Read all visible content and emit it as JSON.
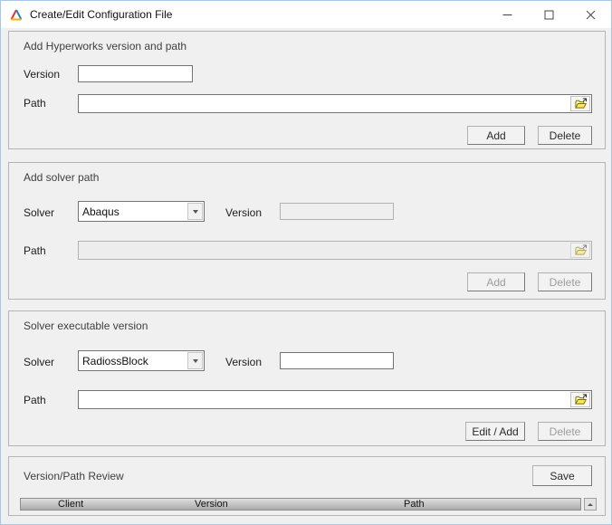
{
  "window": {
    "title": "Create/Edit Configuration File",
    "icons": {
      "app": "altair-triangle-logo",
      "minimize": "minimize-dash",
      "maximize": "maximize-square",
      "close": "close-x",
      "browse": "open-folder",
      "combo_arrow": "chevron-down"
    }
  },
  "colors": {
    "window_border": "#a7c7e7",
    "dialog_bg": "#f0f0f0",
    "titlebar_bg": "#ffffff",
    "folder_yellow": "#ffe75c",
    "disabled_text": "#9d9d9d"
  },
  "groups": {
    "hyperworks": {
      "title": "Add Hyperworks version and path",
      "version_label": "Version",
      "version_value": "",
      "path_label": "Path",
      "path_value": "",
      "add_label": "Add",
      "delete_label": "Delete"
    },
    "solver_path": {
      "title": "Add solver path",
      "solver_label": "Solver",
      "solver_value": "Abaqus",
      "version_label": "Version",
      "version_value": "",
      "path_label": "Path",
      "path_value": "",
      "add_label": "Add",
      "delete_label": "Delete"
    },
    "solver_exec": {
      "title": "Solver executable version",
      "solver_label": "Solver",
      "solver_value": "RadiossBlock",
      "version_label": "Version",
      "version_value": "",
      "path_label": "Path",
      "path_value": "",
      "edit_add_label": "Edit / Add",
      "delete_label": "Delete"
    },
    "review": {
      "title": "Version/Path Review",
      "save_label": "Save",
      "table_headers": [
        "Client",
        "Version",
        "Path"
      ]
    }
  }
}
